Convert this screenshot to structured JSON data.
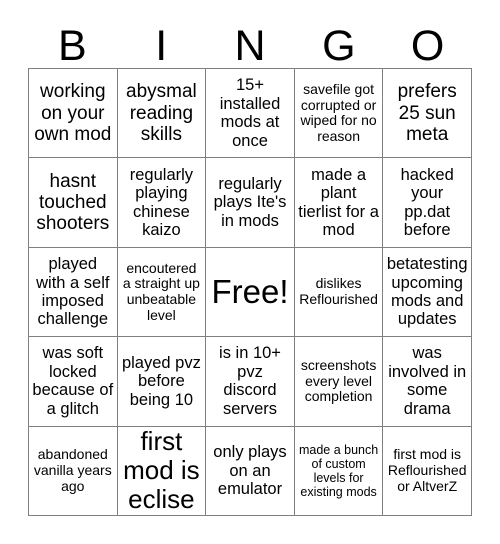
{
  "card": {
    "title": "BINGO",
    "header_letters": [
      "B",
      "I",
      "N",
      "G",
      "O"
    ],
    "colors": {
      "background": "#ffffff",
      "text": "#000000",
      "grid_line": "#808080"
    },
    "rows": [
      [
        {
          "text": "working on your own mod",
          "size": "lg"
        },
        {
          "text": "abysmal reading skills",
          "size": "lg"
        },
        {
          "text": "15+ installed mods at once",
          "size": "md"
        },
        {
          "text": "savefile got corrupted or wiped for no reason",
          "size": "sm"
        },
        {
          "text": "prefers 25 sun meta",
          "size": "lg"
        }
      ],
      [
        {
          "text": "hasnt touched shooters",
          "size": "lg"
        },
        {
          "text": "regularly playing chinese kaizo",
          "size": "md"
        },
        {
          "text": "regularly plays Ite's in mods",
          "size": "md"
        },
        {
          "text": "made a plant tierlist for a mod",
          "size": "md"
        },
        {
          "text": "hacked your pp.dat before",
          "size": "md"
        }
      ],
      [
        {
          "text": "played with a self imposed challenge",
          "size": "md"
        },
        {
          "text": "encoutered a straight up unbeatable level",
          "size": "sm"
        },
        {
          "text": "Free!",
          "size": "free"
        },
        {
          "text": "dislikes Reflourished",
          "size": "sm"
        },
        {
          "text": "betatesting upcoming mods and updates",
          "size": "md"
        }
      ],
      [
        {
          "text": "was soft locked because of a glitch",
          "size": "md"
        },
        {
          "text": "played pvz before being 10",
          "size": "md"
        },
        {
          "text": "is in 10+ pvz discord servers",
          "size": "md"
        },
        {
          "text": "screenshots every level completion",
          "size": "sm"
        },
        {
          "text": "was involved in some drama",
          "size": "md"
        }
      ],
      [
        {
          "text": "abandoned vanilla years ago",
          "size": "sm"
        },
        {
          "text": "first mod is eclise",
          "size": "xl"
        },
        {
          "text": "only plays on an emulator",
          "size": "md"
        },
        {
          "text": "made a bunch of custom levels for existing mods",
          "size": "xs"
        },
        {
          "text": "first mod is Reflourished or AltverZ",
          "size": "sm"
        }
      ]
    ]
  }
}
